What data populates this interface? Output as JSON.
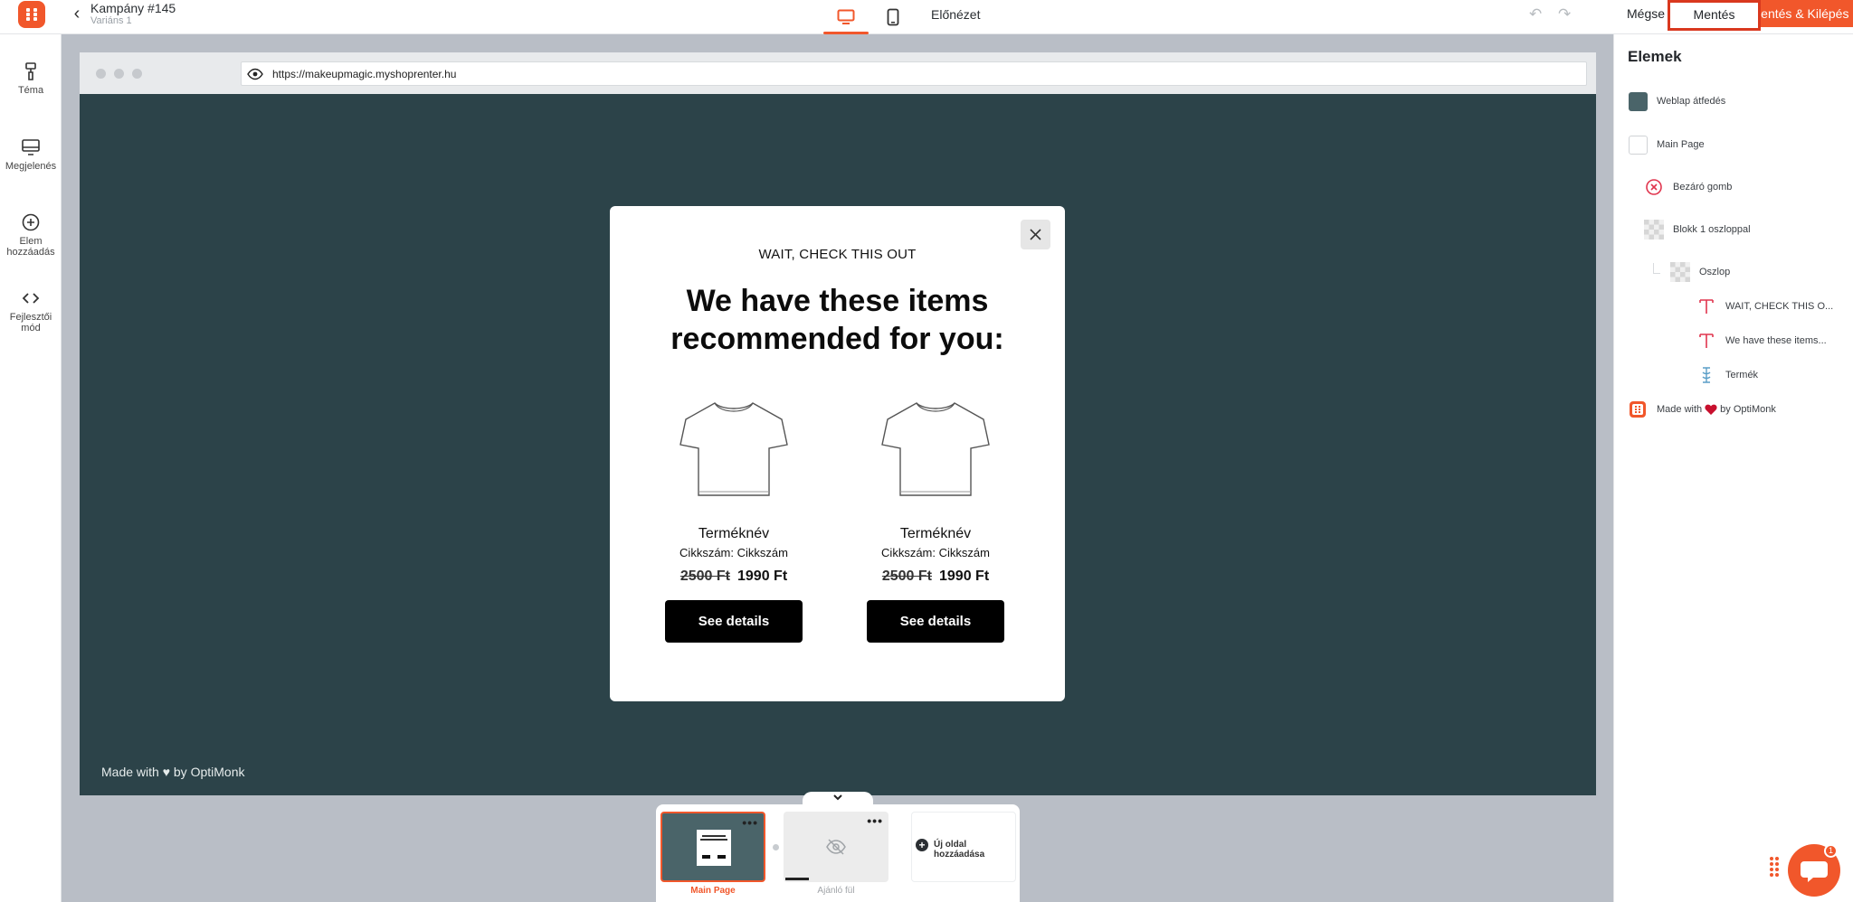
{
  "header": {
    "campaign_title": "Kampány #145",
    "variant_label": "Variáns 1",
    "preview_label": "Előnézet",
    "cancel_label": "Mégse",
    "save_label": "Mentés",
    "save_exit_label": "Mentés & Kilépés",
    "active_device": "desktop"
  },
  "sidebar": {
    "items": [
      {
        "label": "Téma",
        "icon": "paint-roller-icon"
      },
      {
        "label": "Megjelenés",
        "icon": "monitor-icon"
      },
      {
        "label": "Elem hozzáadás",
        "icon": "plus-circle-icon"
      },
      {
        "label": "Fejlesztői mód",
        "icon": "code-icon"
      }
    ]
  },
  "browser": {
    "url": "https://makeupmagic.myshoprenter.hu",
    "made_with": "Made with ♥ by OptiMonk"
  },
  "popup": {
    "kicker": "WAIT, CHECK THIS OUT",
    "headline": "We have these items recommended for you:",
    "products": [
      {
        "name": "Terméknév",
        "sku": "Cikkszám: Cikkszám",
        "old_price": "2500 Ft",
        "price": "1990 Ft",
        "button": "See details"
      },
      {
        "name": "Terméknév",
        "sku": "Cikkszám: Cikkszám",
        "old_price": "2500 Ft",
        "price": "1990 Ft",
        "button": "See details"
      }
    ]
  },
  "pages": {
    "items": [
      {
        "label": "Main Page",
        "active": true
      },
      {
        "label": "Ajánló fül",
        "active": false
      }
    ],
    "add_label": "Új oldal hozzáadása"
  },
  "panel": {
    "title": "Elemek",
    "items": [
      {
        "label": "Weblap átfedés",
        "icon": "color-swatch-icon"
      },
      {
        "label": "Main Page",
        "icon": "page-swatch-icon"
      },
      {
        "label": "Bezáró gomb",
        "icon": "close-circle-icon"
      },
      {
        "label": "Blokk 1 oszloppal",
        "icon": "transparent-block-icon"
      },
      {
        "label": "Oszlop",
        "icon": "transparent-column-icon"
      },
      {
        "label": "WAIT, CHECK THIS O...",
        "icon": "text-icon"
      },
      {
        "label": "We have these items...",
        "icon": "text-icon"
      },
      {
        "label": "Termék",
        "icon": "product-icon"
      },
      {
        "label": "by OptiMonk",
        "prefix": "Made with",
        "icon": "optimonk-logo-icon"
      }
    ]
  },
  "chat": {
    "badge": "1"
  },
  "colors": {
    "accent": "#f1572b",
    "overlay": "#2c4349",
    "canvas": "#b9bec6",
    "save_outline": "#d9381e"
  }
}
